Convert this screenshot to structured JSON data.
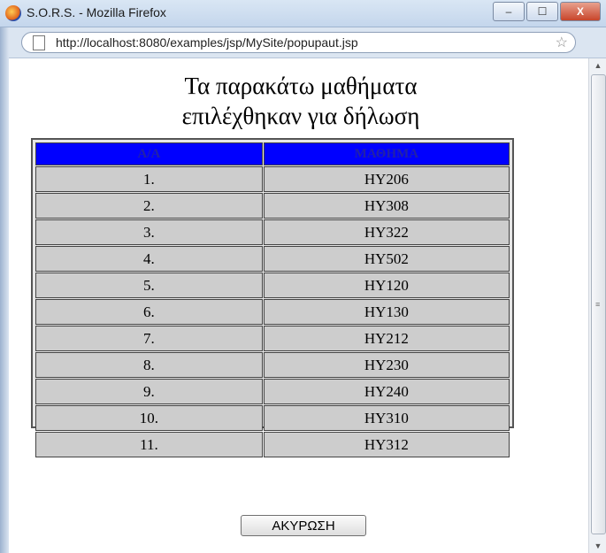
{
  "window": {
    "title": "S.O.R.S. - Mozilla Firefox",
    "minimize": "–",
    "maximize": "☐",
    "close": "X"
  },
  "address_bar": {
    "url": "http://localhost:8080/examples/jsp/MySite/popupaut.jsp"
  },
  "page": {
    "heading_line1": "Τα παρακάτω μαθήματα",
    "heading_line2": "επιλέχθηκαν για δήλωση"
  },
  "table": {
    "headers": [
      "Α/Α",
      "ΜΑΘΗΜΑ"
    ],
    "rows": [
      [
        "1.",
        "HY206"
      ],
      [
        "2.",
        "HY308"
      ],
      [
        "3.",
        "HY322"
      ],
      [
        "4.",
        "HY502"
      ],
      [
        "5.",
        "HY120"
      ],
      [
        "6.",
        "HY130"
      ],
      [
        "7.",
        "HY212"
      ],
      [
        "8.",
        "HY230"
      ],
      [
        "9.",
        "HY240"
      ],
      [
        "10.",
        "HY310"
      ],
      [
        "11.",
        "HY312"
      ]
    ]
  },
  "buttons": {
    "cancel": "ΑΚΥΡΩΣΗ"
  },
  "icons": {
    "app": "firefox-icon",
    "page": "page-icon",
    "bookmark": "star-icon"
  },
  "colors": {
    "header_bg": "#0000ff",
    "cell_bg": "#cdcdcd"
  }
}
